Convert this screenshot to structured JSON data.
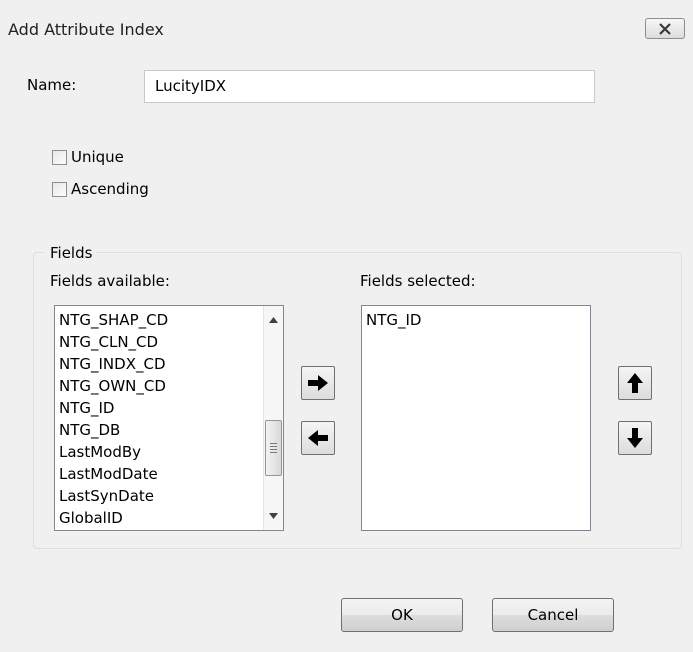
{
  "window": {
    "title": "Add Attribute Index"
  },
  "name_field": {
    "label": "Name:",
    "value": "LucityIDX"
  },
  "options": {
    "unique_label": "Unique",
    "unique_checked": false,
    "ascending_label": "Ascending",
    "ascending_checked": false
  },
  "fields_group": {
    "legend": "Fields",
    "available_label": "Fields available:",
    "selected_label": "Fields selected:",
    "available_items": [
      "NTG_SHAP_CD",
      "NTG_CLN_CD",
      "NTG_INDX_CD",
      "NTG_OWN_CD",
      "NTG_ID",
      "NTG_DB",
      "LastModBy",
      "LastModDate",
      "LastSynDate",
      "GlobalID"
    ],
    "selected_items": [
      "NTG_ID"
    ]
  },
  "buttons": {
    "ok_label": "OK",
    "cancel_label": "Cancel"
  },
  "icons": {
    "close": "close-icon",
    "add_field": "arrow-right-icon",
    "remove_field": "arrow-left-icon",
    "move_up": "arrow-up-icon",
    "move_down": "arrow-down-icon"
  }
}
